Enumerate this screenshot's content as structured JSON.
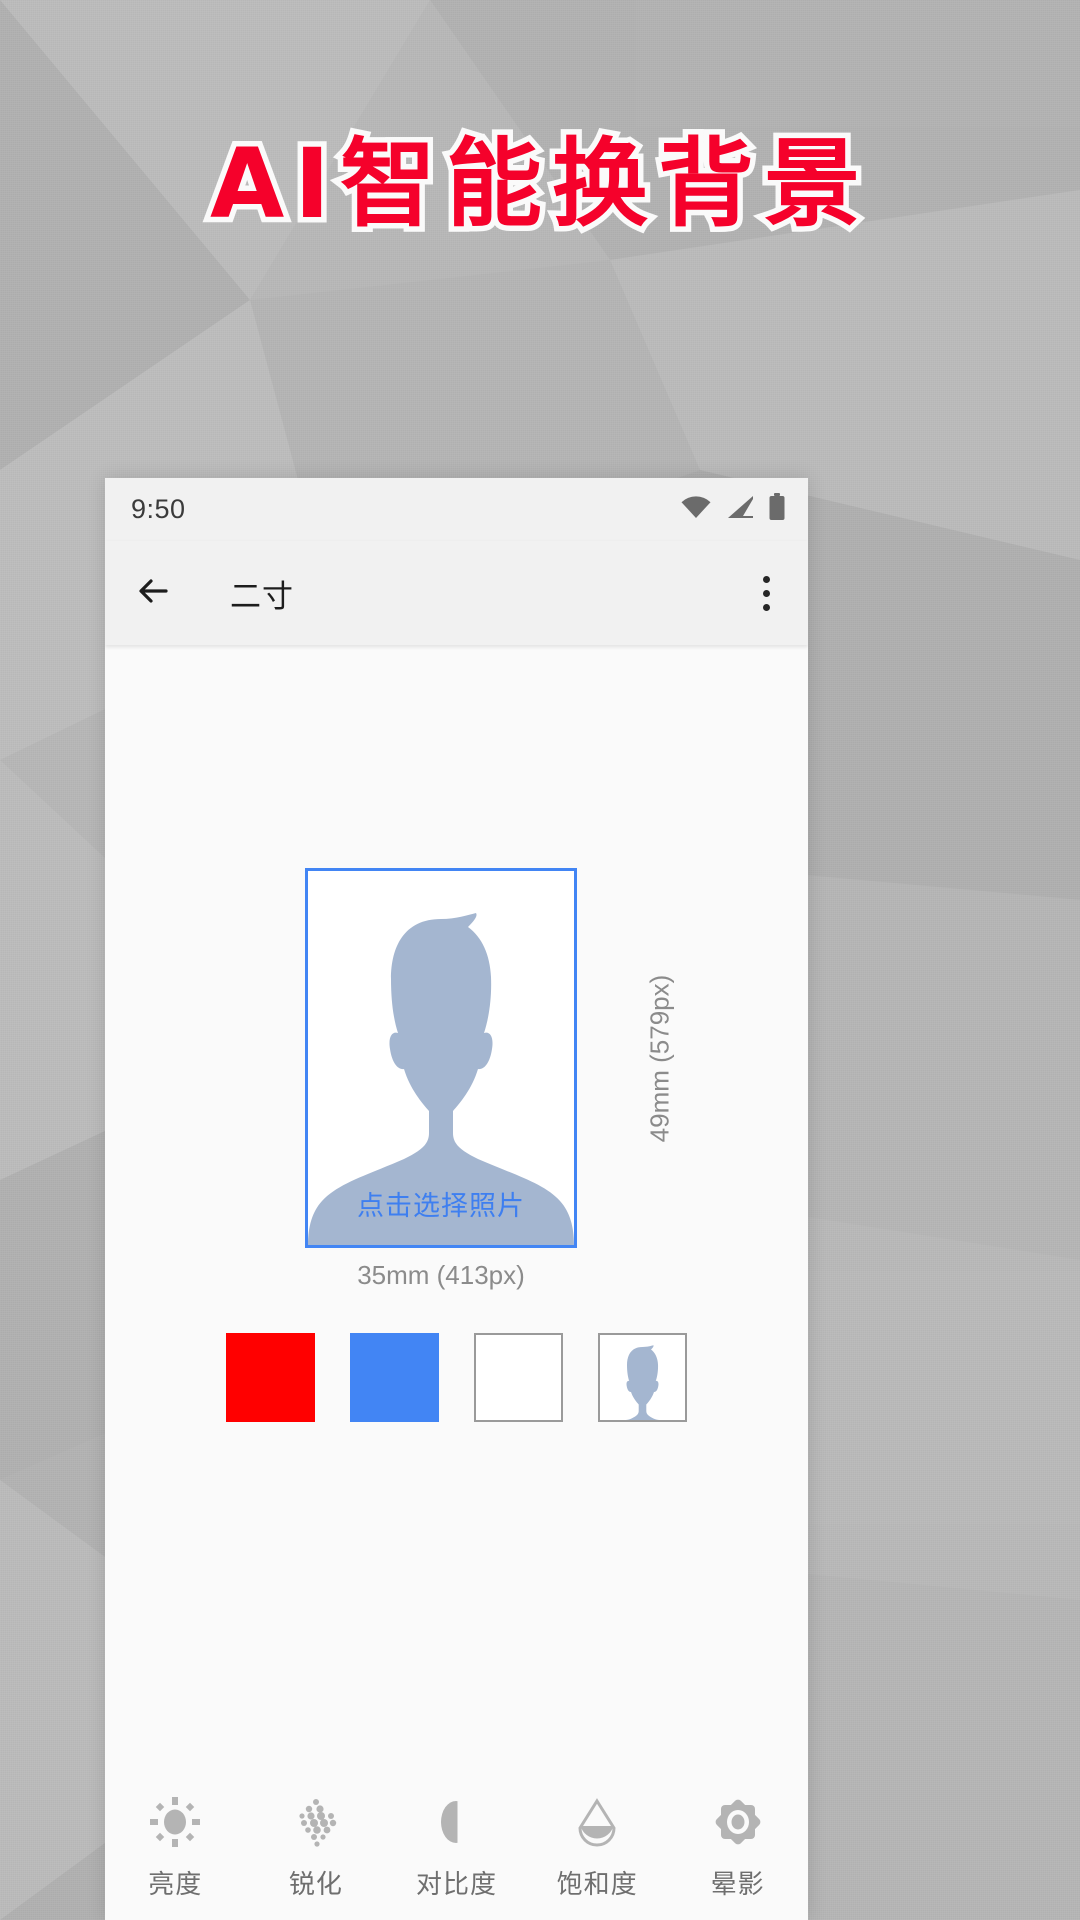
{
  "promo": {
    "headline": "AI智能换背景",
    "headline_color": "#f5012b",
    "outline_color": "#fafafa",
    "backdrop_color": "#b6b6b6"
  },
  "phone": {
    "status_bar": {
      "time": "9:50",
      "icons": [
        "wifi-icon",
        "cellular-signal-icon",
        "battery-icon"
      ]
    },
    "app_bar": {
      "back_icon": "arrow-left-icon",
      "title": "二寸",
      "overflow_icon": "more-vertical-icon"
    },
    "preview": {
      "cta_label": "点击选择照片",
      "cta_color": "#3e7ff0",
      "frame_border_color": "#4285f4",
      "width_label": "35mm (413px)",
      "height_label": "49mm (579px)",
      "placeholder_fill": "#a4b6d0"
    },
    "backgrounds": {
      "title": "background-swatches",
      "options": [
        {
          "name": "red",
          "color": "#ff0000",
          "kind": "solid"
        },
        {
          "name": "blue",
          "color": "#4285f4",
          "kind": "solid"
        },
        {
          "name": "white",
          "color": "#ffffff",
          "kind": "solid"
        },
        {
          "name": "original",
          "color": "#ffffff",
          "kind": "photo"
        }
      ]
    },
    "toolbar": {
      "items": [
        {
          "label": "亮度",
          "icon": "brightness-icon"
        },
        {
          "label": "锐化",
          "icon": "sharpen-icon"
        },
        {
          "label": "对比度",
          "icon": "contrast-icon"
        },
        {
          "label": "饱和度",
          "icon": "saturation-icon"
        },
        {
          "label": "晕影",
          "icon": "vignette-icon"
        }
      ]
    }
  }
}
